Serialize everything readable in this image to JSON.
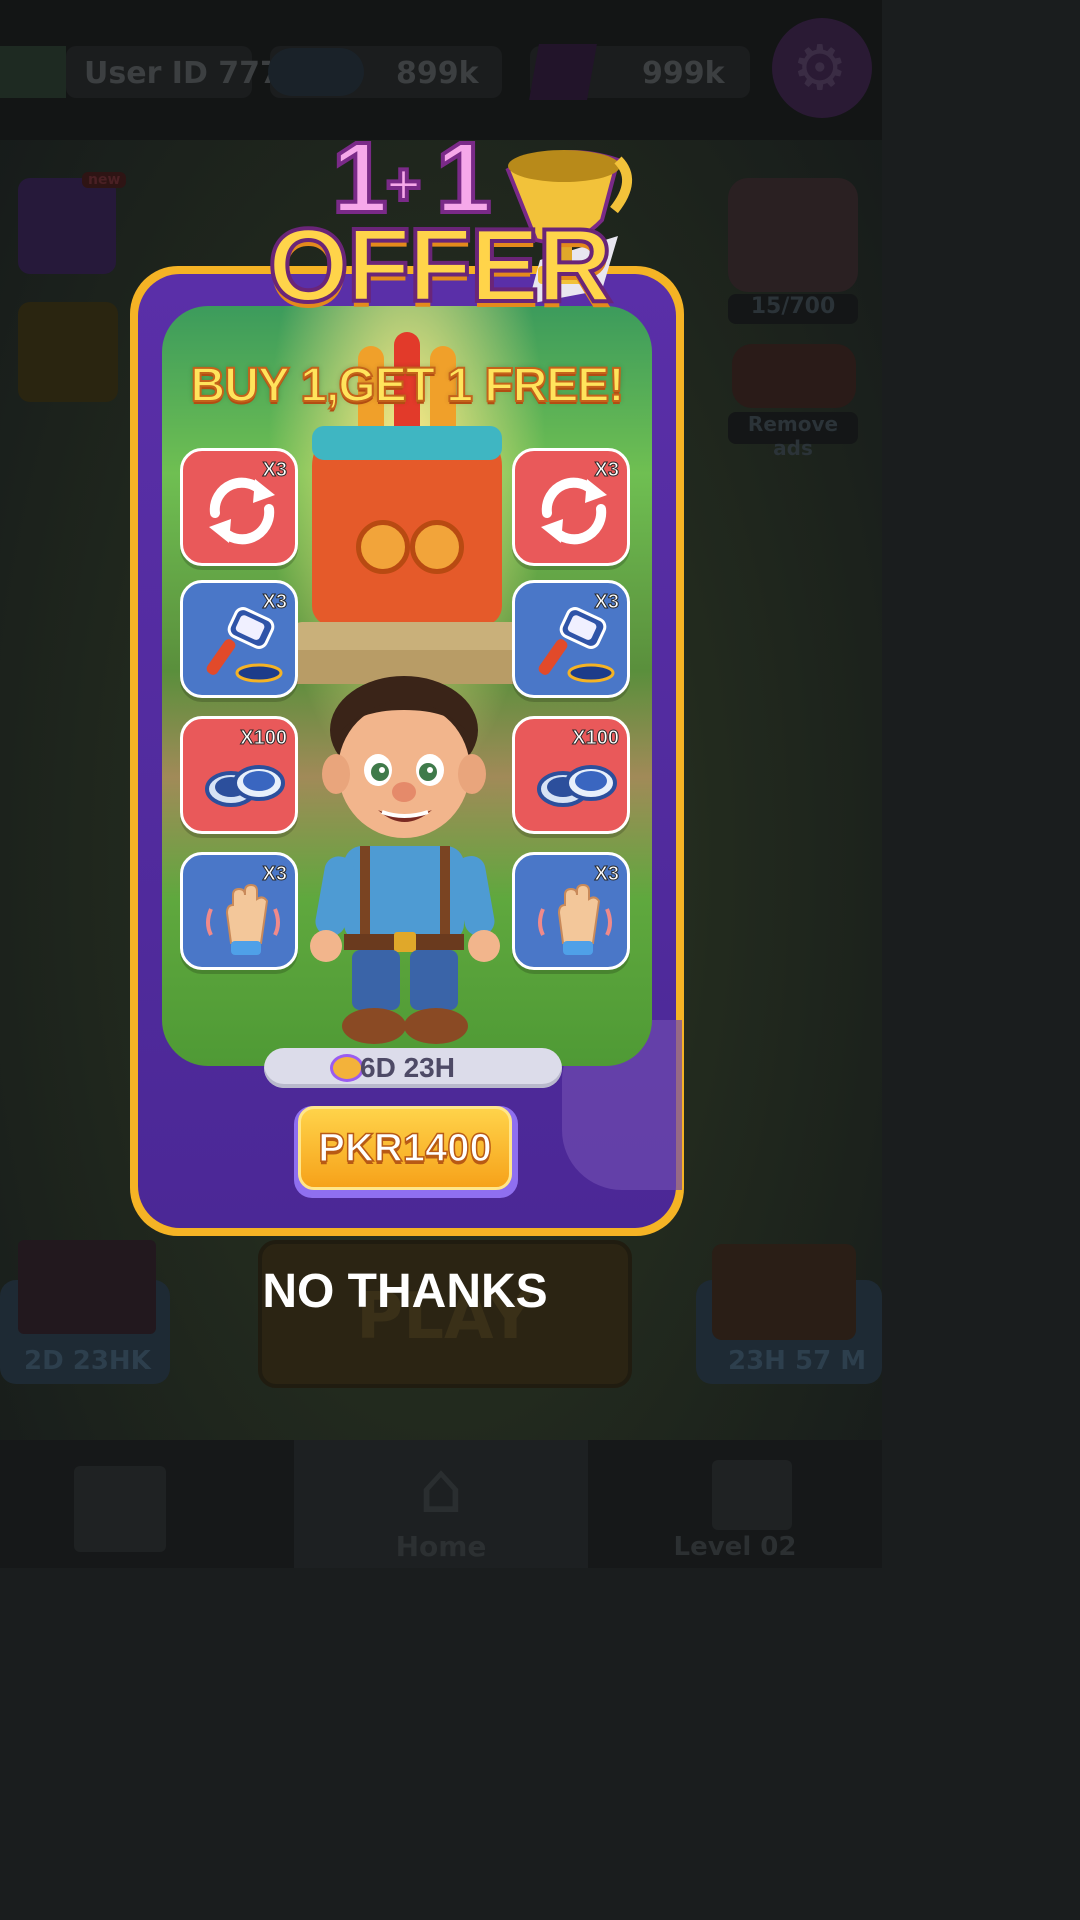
{
  "hud": {
    "user_id": "User ID  777",
    "chips": "899k",
    "gems": "999k"
  },
  "side": {
    "new_badge": "new",
    "piggy_progress": "15/700",
    "remove_ads": "Remove ads"
  },
  "bottom": {
    "chest_timer": "2D 23HK",
    "play_label": "PLAY",
    "gift_timer": "23H 57 M",
    "nav_home": "Home",
    "nav_level": "Level 02"
  },
  "offer": {
    "badge_top_left": "1",
    "badge_plus": "+",
    "badge_top_right": "1",
    "badge_word": "OFFER",
    "headline": "BUY 1,GET 1 FREE!",
    "items_left": [
      {
        "icon": "refresh-icon",
        "qty": "X3",
        "color": "#e9595a"
      },
      {
        "icon": "hammer-icon",
        "qty": "X3",
        "color": "#4a77c8"
      },
      {
        "icon": "chips-icon",
        "qty": "X100",
        "color": "#e9595a"
      },
      {
        "icon": "wave-hand-icon",
        "qty": "X3",
        "color": "#4a77c8"
      }
    ],
    "items_right": [
      {
        "icon": "refresh-icon",
        "qty": "X3",
        "color": "#e9595a"
      },
      {
        "icon": "hammer-icon",
        "qty": "X3",
        "color": "#4a77c8"
      },
      {
        "icon": "chips-icon",
        "qty": "X100",
        "color": "#e9595a"
      },
      {
        "icon": "wave-hand-icon",
        "qty": "X3",
        "color": "#4a77c8"
      }
    ],
    "timer": "6D 23H",
    "price": "PKR1400",
    "dismiss": "NO THANKS"
  },
  "colors": {
    "frame_gold": "#f5b325",
    "panel_purple": "#5a2fa8",
    "button_yellow": "#ffd34a"
  }
}
